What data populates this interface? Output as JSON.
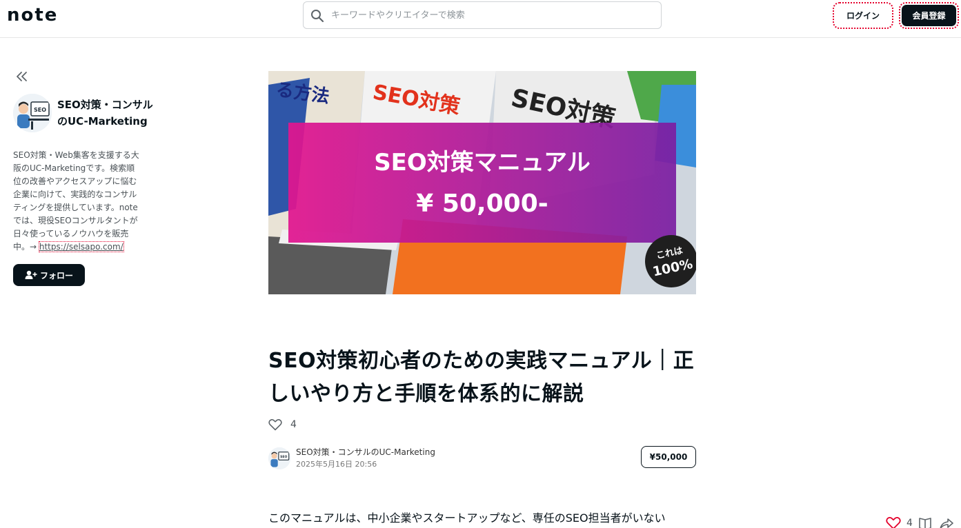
{
  "header": {
    "logo_text": "note",
    "search_placeholder": "キーワードやクリエイターで検索",
    "login_label": "ログイン",
    "signup_label": "会員登録"
  },
  "sidebar": {
    "creator_name": "SEO対策・コンサルのUC-Marketing",
    "bio": "SEO対策・Web集客を支援する大阪のUC-Marketingです。検索順位の改善やアクセスアップに悩む企業に向けて、実践的なコンサルティングを提供しています。noteでは、現役SEOコンサルタントが日々使っているノウハウを販売中。→ ",
    "bio_link": "https://selsapo.com/",
    "follow_label": "フォロー"
  },
  "hero": {
    "heading": "SEO対策マニュアル",
    "price": "¥ 50,000-",
    "badge_line1": "これは",
    "badge_line2": "100%"
  },
  "article": {
    "title": "SEO対策初心者のための実践マニュアル｜正しいやり方と手順を体系的に解説",
    "like_count": "4",
    "author_name": "SEO対策・コンサルのUC-Marketing",
    "date": "2025年5月16日 20:56",
    "price": "¥50,000",
    "body_start": "このマニュアルは、中小企業やスタートアップなど、専任のSEO担当者がいない"
  },
  "floating": {
    "like_count": "4"
  },
  "colors": {
    "primary": "#08131a",
    "focus_outline": "#e4002b",
    "hero_gradient_start": "#e1158f",
    "hero_gradient_end": "#7b1fa2"
  }
}
